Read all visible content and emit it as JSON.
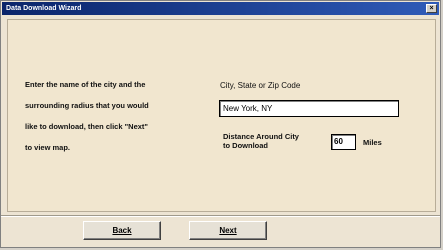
{
  "window": {
    "title": "Data Download Wizard",
    "close_glyph": "×"
  },
  "instructions": {
    "lines": [
      "Enter the name of the city and the",
      "surrounding radius that you would",
      "like to download, then click \"Next\"",
      "to view map."
    ]
  },
  "city": {
    "label": "City, State or Zip Code",
    "value": "New York, NY"
  },
  "distance": {
    "label_line1": "Distance Around City",
    "label_line2": "to Download",
    "value": "60",
    "units": "Miles"
  },
  "buttons": {
    "back_label": "Back",
    "next_label": "Next"
  }
}
